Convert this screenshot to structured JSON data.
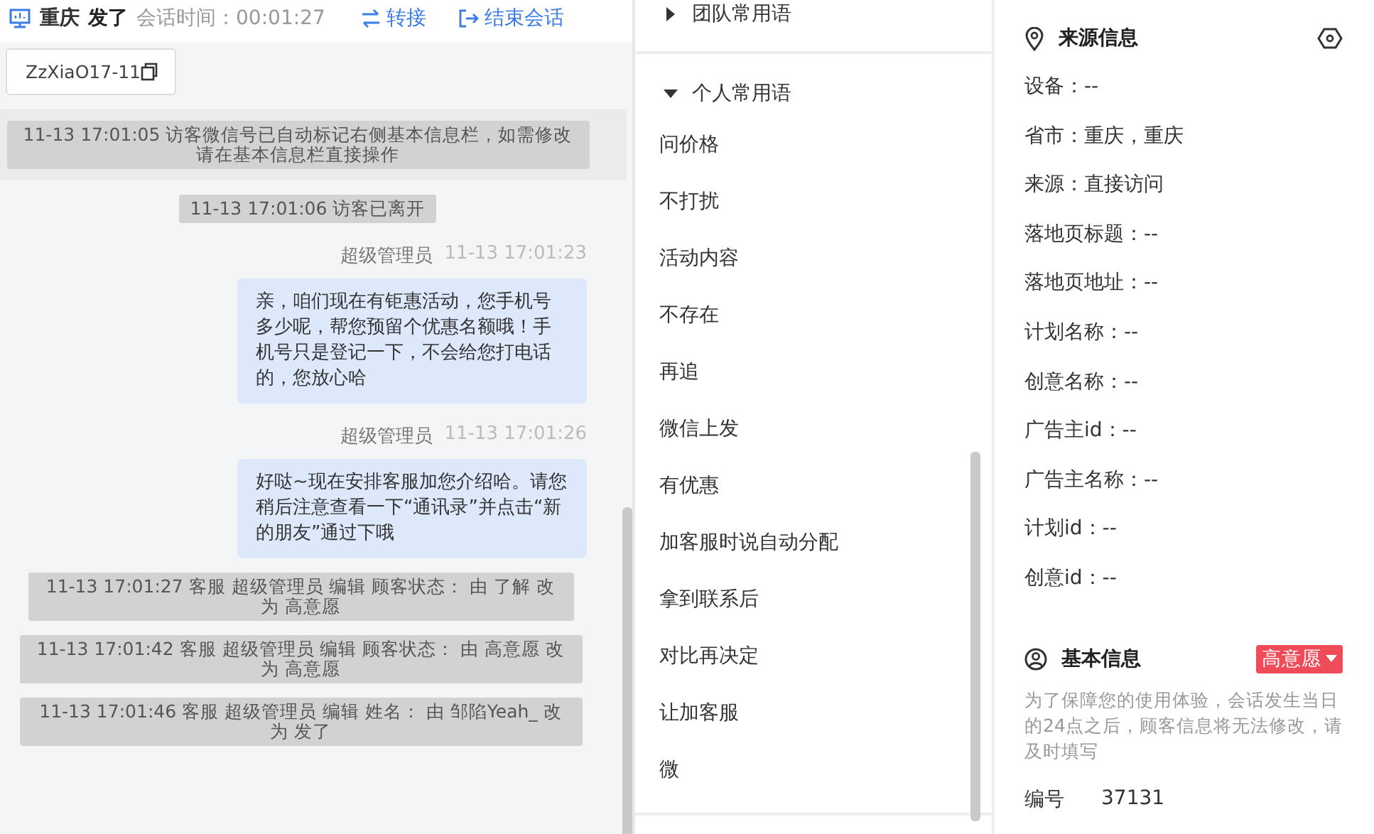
{
  "chat_header": {
    "visitor_region": "重庆",
    "visitor_name": "发了",
    "session_time": "会话时间：00:01:27",
    "actions": [
      {
        "kind": "transfer",
        "label": "转接"
      },
      {
        "kind": "end",
        "label": "结束会话"
      }
    ]
  },
  "visitor_id": "ZzXiaO17-11",
  "messages": [
    {
      "kind": "notice",
      "highlight": true,
      "text": "11-13 17:01:05 访客微信号已自动标记右侧基本信息栏，如需修改请在基本信息栏直接操作"
    },
    {
      "kind": "notice",
      "highlight": false,
      "text": "11-13 17:01:06 访客已离开"
    },
    {
      "kind": "agent",
      "sender": "超级管理员",
      "time": "11-13 17:01:23",
      "text": "亲，咱们现在有钜惠活动，您手机号多少呢，帮您预留个优惠名额哦！手机号只是登记一下，不会给您打电话的，您放心哈"
    },
    {
      "kind": "agent",
      "sender": "超级管理员",
      "time": "11-13 17:01:26",
      "text": "好哒~现在安排客服加您介绍哈。请您稍后注意查看一下“通讯录”并点击“新的朋友”通过下哦"
    },
    {
      "kind": "notice",
      "highlight": false,
      "text": "11-13 17:01:27 客服 超级管理员 编辑 顾客状态： 由 了解 改为 高意愿"
    },
    {
      "kind": "notice",
      "highlight": false,
      "text": "11-13 17:01:42 客服 超级管理员 编辑 顾客状态： 由 高意愿 改为 高意愿"
    },
    {
      "kind": "notice",
      "highlight": false,
      "text": "11-13 17:01:46 客服 超级管理员 编辑 姓名： 由 邹陷Yeah_ 改为 发了"
    }
  ],
  "phrase_groups": [
    {
      "label": "团队常用语",
      "expanded": false
    },
    {
      "label": "个人常用语",
      "expanded": true,
      "items": [
        "问价格",
        "不打扰",
        "活动内容",
        "不存在",
        "再追",
        "微信上发",
        "有优惠",
        "加客服时说自动分配",
        "拿到联系后",
        "对比再决定",
        "让加客服",
        "微"
      ]
    }
  ],
  "source_info": {
    "title": "来源信息",
    "fields": [
      "设备：--",
      "省市：重庆，重庆",
      "来源：直接访问",
      "落地页标题：--",
      "落地页地址：--",
      "计划名称：--",
      "创意名称：--",
      "广告主id：--",
      "广告主名称：--",
      "计划id：--",
      "创意id：--"
    ]
  },
  "basic_info": {
    "title": "基本信息",
    "status_tag": "高意愿",
    "notice": "为了保障您的使用体验，会话发生当日的24点之后，顾客信息将无法修改，请及时填写",
    "fields": [
      {
        "label": "编号",
        "value": "37131"
      }
    ]
  }
}
